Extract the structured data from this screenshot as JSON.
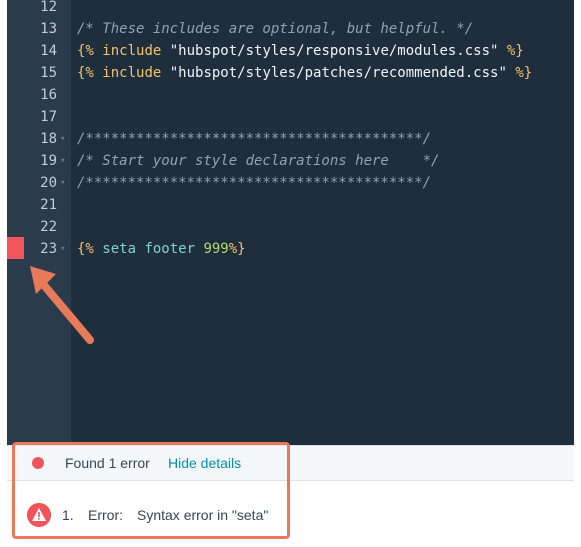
{
  "editor": {
    "lines": [
      {
        "num": "12",
        "fold": false,
        "tokens": []
      },
      {
        "num": "13",
        "fold": false,
        "tokens": [
          {
            "cls": "c-comment",
            "text": "/* These includes are optional, but helpful. */"
          }
        ]
      },
      {
        "num": "14",
        "fold": false,
        "tokens": [
          {
            "cls": "c-tag",
            "text": "{% "
          },
          {
            "cls": "c-kw",
            "text": "include "
          },
          {
            "cls": "c-str",
            "text": "\"hubspot/styles/responsive/modules.css\""
          },
          {
            "cls": "c-tag",
            "text": " %}"
          }
        ]
      },
      {
        "num": "15",
        "fold": false,
        "tokens": [
          {
            "cls": "c-tag",
            "text": "{% "
          },
          {
            "cls": "c-kw",
            "text": "include "
          },
          {
            "cls": "c-str",
            "text": "\"hubspot/styles/patches/recommended.css\""
          },
          {
            "cls": "c-tag",
            "text": " %}"
          }
        ]
      },
      {
        "num": "16",
        "fold": false,
        "tokens": []
      },
      {
        "num": "17",
        "fold": false,
        "tokens": []
      },
      {
        "num": "18",
        "fold": true,
        "tokens": [
          {
            "cls": "c-comment",
            "text": "/****************************************/"
          }
        ]
      },
      {
        "num": "19",
        "fold": true,
        "tokens": [
          {
            "cls": "c-comment",
            "text": "/* Start your style declarations here    */"
          }
        ]
      },
      {
        "num": "20",
        "fold": true,
        "tokens": [
          {
            "cls": "c-comment",
            "text": "/****************************************/"
          }
        ]
      },
      {
        "num": "21",
        "fold": false,
        "tokens": []
      },
      {
        "num": "22",
        "fold": false,
        "tokens": []
      },
      {
        "num": "23",
        "fold": true,
        "tokens": [
          {
            "cls": "c-tag",
            "text": "{% "
          },
          {
            "cls": "c-name",
            "text": "seta footer "
          },
          {
            "cls": "c-num",
            "text": "999"
          },
          {
            "cls": "c-tag",
            "text": "%}"
          }
        ]
      }
    ],
    "error_line": "23"
  },
  "panel": {
    "found_text": "Found 1 error",
    "hide_link": "Hide details",
    "error_index": "1.",
    "error_label": "Error:",
    "error_message": "Syntax error in \"seta\""
  },
  "colors": {
    "error": "#f2545b",
    "annotation": "#e8795a",
    "link": "#0091ae",
    "editor_bg": "#1f2e3c"
  },
  "icons": {
    "status_dot": "error-dot-icon",
    "error_badge": "warning-triangle-icon",
    "fold": "fold-arrow-icon",
    "annotation_arrow": "pointer-arrow-icon"
  }
}
